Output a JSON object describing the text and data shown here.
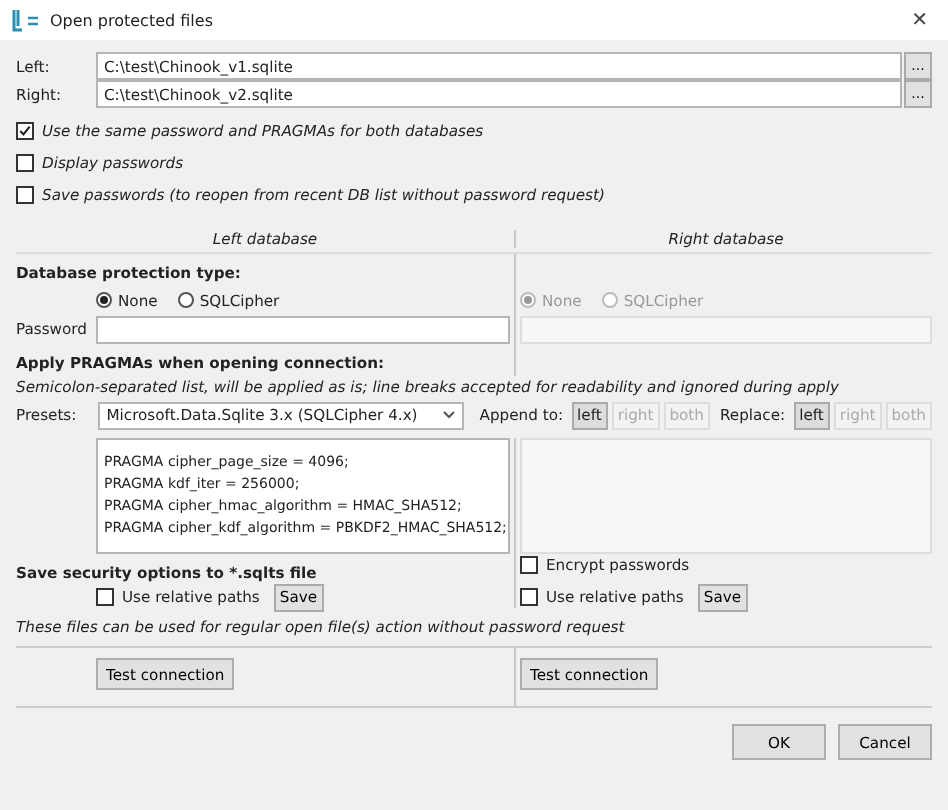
{
  "window": {
    "title": "Open protected files",
    "close": "✕"
  },
  "files": [
    {
      "label": "Left:",
      "value": "C:\\test\\Chinook_v1.sqlite",
      "browse": "..."
    },
    {
      "label": "Right:",
      "value": "C:\\test\\Chinook_v2.sqlite",
      "browse": "..."
    }
  ],
  "options": [
    {
      "label": "Use the same password and PRAGMAs for both databases",
      "checked": true
    },
    {
      "label": "Display passwords",
      "checked": false
    },
    {
      "label": "Save passwords (to reopen from recent DB list without password request)",
      "checked": false
    }
  ],
  "columns": [
    "Left database",
    "Right database"
  ],
  "protection": {
    "heading": "Database protection type:",
    "password_label": "Password",
    "sides": [
      {
        "disabled": false,
        "radios": [
          {
            "label": "None",
            "selected": true
          },
          {
            "label": "SQLCipher",
            "selected": false
          }
        ]
      },
      {
        "disabled": true,
        "radios": [
          {
            "label": "None",
            "selected": true
          },
          {
            "label": "SQLCipher",
            "selected": false
          }
        ]
      }
    ]
  },
  "pragmas": {
    "heading": "Apply PRAGMAs when opening connection:",
    "hint": "Semicolon-separated list, will be applied as is; line breaks accepted for readability and ignored during apply",
    "presets_label": "Presets:",
    "preset": "Microsoft.Data.Sqlite 3.x (SQLCipher 4.x)",
    "append_label": "Append to:",
    "append": [
      {
        "label": "left",
        "selected": true
      },
      {
        "label": "right",
        "selected": false
      },
      {
        "label": "both",
        "selected": false
      }
    ],
    "replace_label": "Replace:",
    "replace": [
      {
        "label": "left",
        "selected": true
      },
      {
        "label": "right",
        "selected": false
      },
      {
        "label": "both",
        "selected": false
      }
    ],
    "lines": [
      "PRAGMA cipher_page_size = 4096;",
      "PRAGMA kdf_iter = 256000;",
      "PRAGMA cipher_hmac_algorithm = HMAC_SHA512;",
      "PRAGMA cipher_kdf_algorithm = PBKDF2_HMAC_SHA512;"
    ]
  },
  "save": {
    "heading": "Save security options to *.sqlts file",
    "encrypt": {
      "label": "Encrypt passwords",
      "checked": false
    },
    "sides": [
      {
        "label": "Use relative paths",
        "checked": false,
        "button": "Save"
      },
      {
        "label": "Use relative paths",
        "checked": false,
        "button": "Save"
      }
    ],
    "note": "These files can be used for regular open file(s) action without password request"
  },
  "test_buttons": [
    "Test connection",
    "Test connection"
  ],
  "footer": [
    "OK",
    "Cancel"
  ]
}
